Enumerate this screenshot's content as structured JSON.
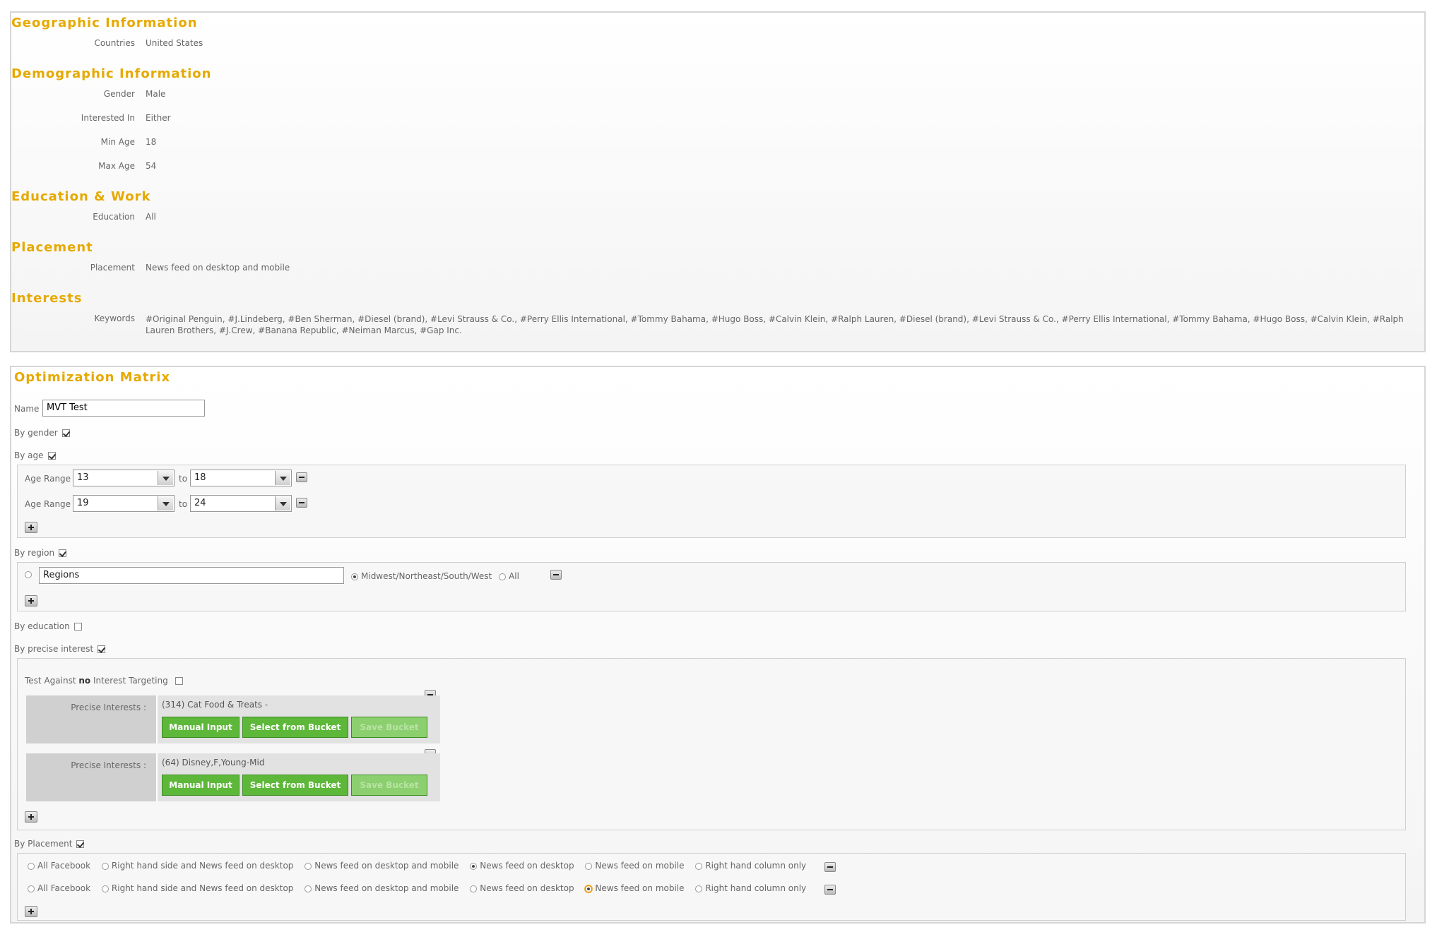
{
  "summary": {
    "geo": {
      "title": "Geographic Information",
      "countries_label": "Countries",
      "countries_value": "United States"
    },
    "demo": {
      "title": "Demographic Information",
      "gender_label": "Gender",
      "gender_value": "Male",
      "interested_label": "Interested In",
      "interested_value": "Either",
      "minage_label": "Min Age",
      "minage_value": "18",
      "maxage_label": "Max Age",
      "maxage_value": "54"
    },
    "edu": {
      "title": "Education & Work",
      "education_label": "Education",
      "education_value": "All"
    },
    "placement": {
      "title": "Placement",
      "placement_label": "Placement",
      "placement_value": "News feed on desktop and mobile"
    },
    "interests": {
      "title": "Interests",
      "keywords_label": "Keywords",
      "keywords_value": "#Original Penguin, #J.Lindeberg, #Ben Sherman, #Diesel (brand), #Levi Strauss & Co., #Perry Ellis International, #Tommy Bahama, #Hugo Boss, #Calvin Klein, #Ralph Lauren, #Diesel (brand), #Levi Strauss & Co., #Perry Ellis International, #Tommy Bahama, #Hugo Boss, #Calvin Klein, #Ralph Lauren Brothers, #J.Crew, #Banana Republic, #Neiman Marcus, #Gap Inc."
    }
  },
  "matrix": {
    "title": "Optimization Matrix",
    "name_label": "Name",
    "name_value": "MVT Test",
    "by_gender_label": "By gender",
    "by_age_label": "By age",
    "age_ranges": [
      {
        "label": "Age Range",
        "from": "13",
        "to_label": "to",
        "to": "18"
      },
      {
        "label": "Age Range",
        "from": "19",
        "to_label": "to",
        "to": "24"
      }
    ],
    "by_region_label": "By region",
    "region_select": "Regions",
    "region_option_1": "Midwest/Northeast/South/West",
    "region_option_2": "All",
    "by_education_label": "By education",
    "by_precise_interest_label": "By precise interest",
    "test_against_prefix": "Test Against",
    "test_against_bold": "no",
    "test_against_suffix": "Interest Targeting",
    "precise_interests": [
      {
        "label": "Precise Interests :",
        "value": "(314) Cat Food & Treats -"
      },
      {
        "label": "Precise Interests :",
        "value": "(64) Disney,F,Young-Mid"
      }
    ],
    "buttons": {
      "manual": "Manual Input",
      "select_bucket": "Select from Bucket",
      "save_bucket": "Save Bucket"
    },
    "by_placement_label": "By Placement",
    "placement_options": [
      "All Facebook",
      "Right hand side and News feed on desktop",
      "News feed on desktop and mobile",
      "News feed on desktop",
      "News feed on mobile",
      "Right hand column only"
    ]
  }
}
